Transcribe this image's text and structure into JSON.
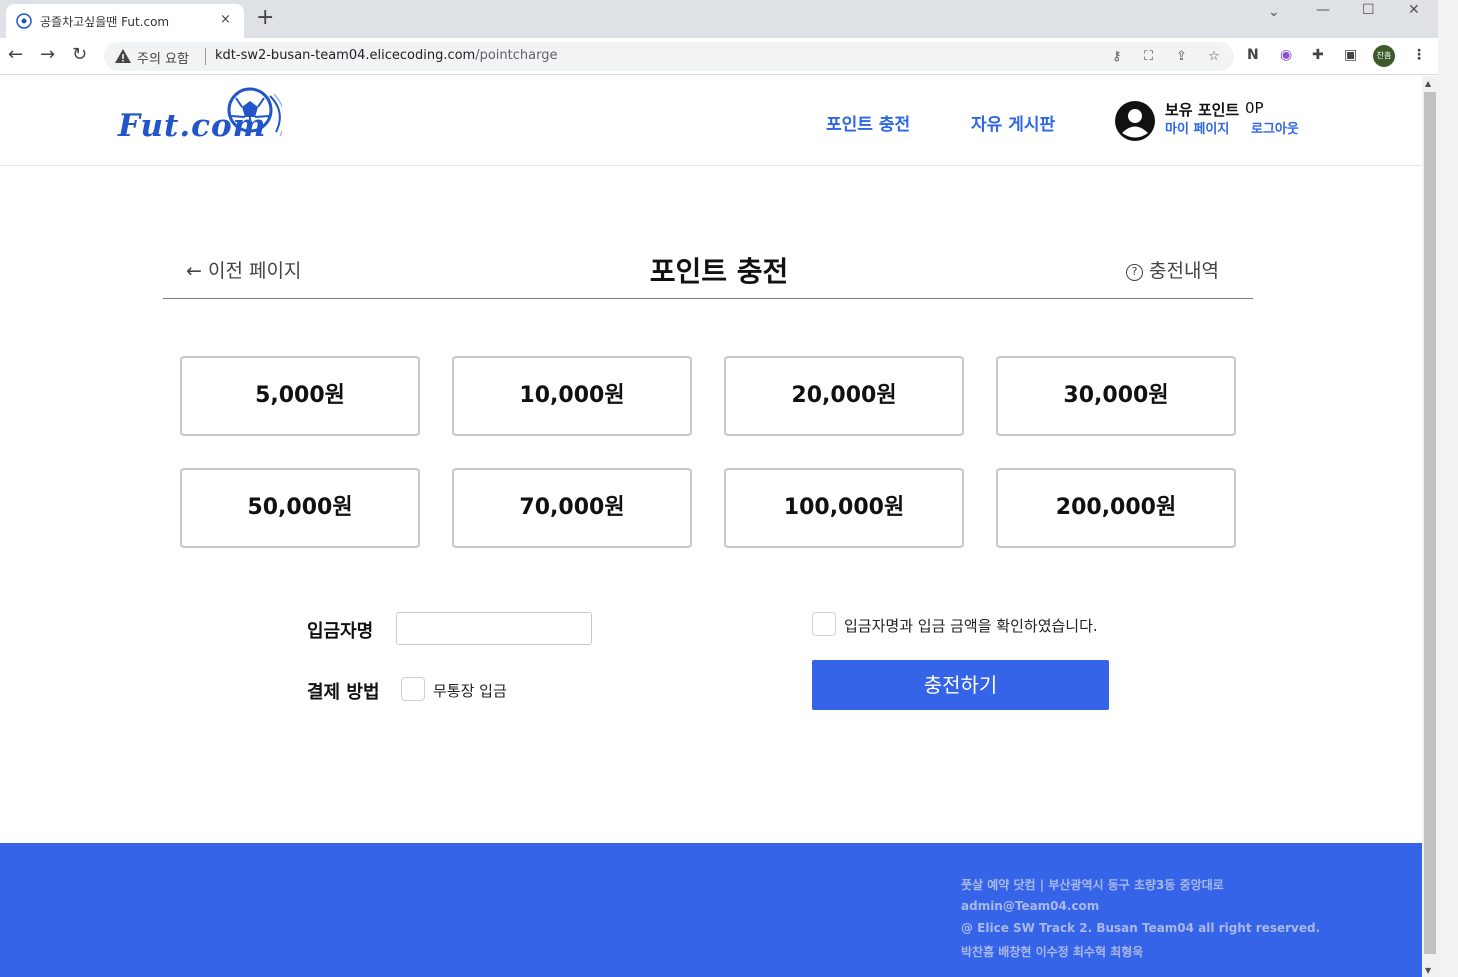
{
  "browser": {
    "tab_title": "공즐차고싶을땐 Fut.com",
    "new_tab": "+",
    "close_tab": "×",
    "security_warning": "주의 요함",
    "url_host": "kdt-sw2-busan-team04.elicecoding.com",
    "url_path": "/pointcharge",
    "profile_initials": "찬흠"
  },
  "header": {
    "logo_text": "Fut.com",
    "nav": [
      "포인트 충전",
      "자유 게시판"
    ],
    "points_label": "보유 포인트",
    "points_value": "0P",
    "mypage": "마이 페이지",
    "logout": "로그아웃"
  },
  "main": {
    "back_label": "이전 페이지",
    "title": "포인트 충전",
    "history_label": "충전내역",
    "amounts": [
      "5,000원",
      "10,000원",
      "20,000원",
      "30,000원",
      "50,000원",
      "70,000원",
      "100,000원",
      "200,000원"
    ],
    "depositor_label": "입금자명",
    "depositor_value": "",
    "payment_label": "결제 방법",
    "payment_option": "무통장 입금",
    "confirm_text": "입금자명과 입금 금액을 확인하였습니다.",
    "submit_label": "충전하기"
  },
  "footer": {
    "lines": [
      "풋살 예약 닷컴 | 부산광역시 동구 초량3동 중앙대로",
      "admin@Team04.com",
      "@ Elice SW Track 2. Busan Team04 all right reserved.",
      "박찬흠 배창현 이수정 최수혁 최형욱"
    ]
  },
  "colors": {
    "brand": "#3564e8",
    "link": "#2f66e6"
  }
}
